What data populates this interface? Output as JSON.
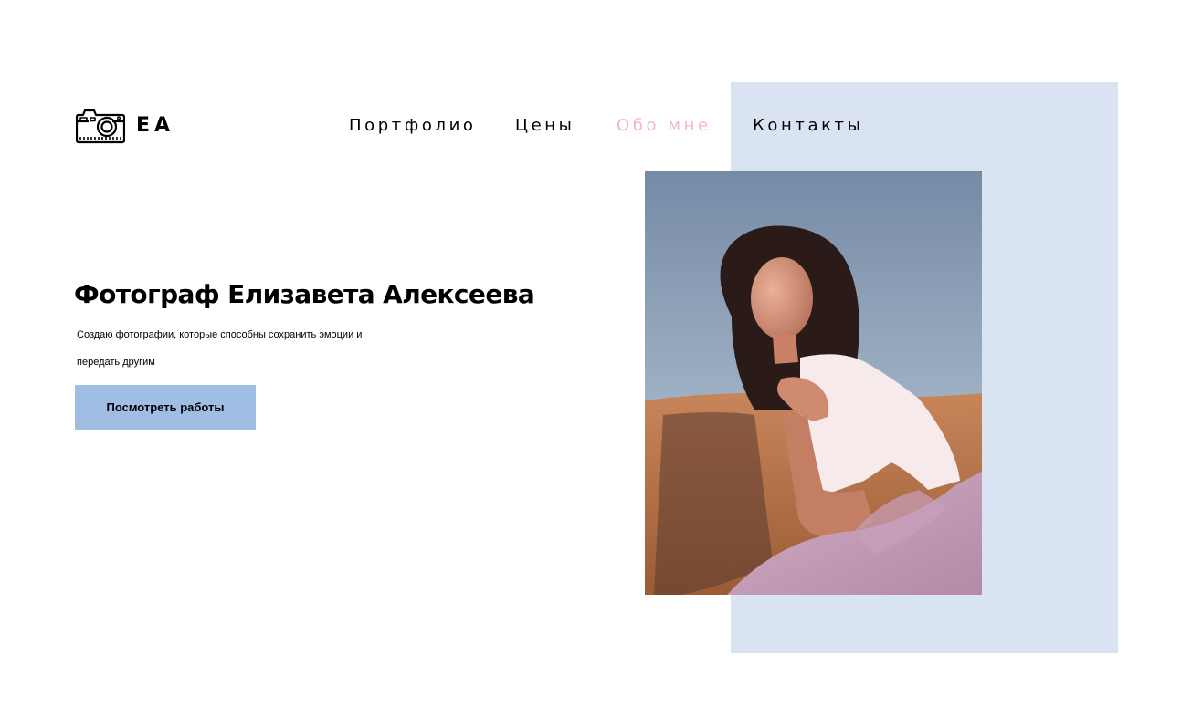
{
  "brand": {
    "icon": "camera-icon",
    "initials": "EA"
  },
  "nav": {
    "items": [
      {
        "label": "Портфолио",
        "active": false
      },
      {
        "label": "Цены",
        "active": false
      },
      {
        "label": "Обо мне",
        "active": true
      },
      {
        "label": "Контакты",
        "active": false
      }
    ]
  },
  "hero": {
    "title": "Фотограф Елизавета Алексеева",
    "subtitle": "Создаю фотографии, которые способны сохранить эмоции и передать другим",
    "cta_label": "Посмотреть работы"
  },
  "colors": {
    "accent_panel": "#d9e3f1",
    "button": "#a0bde3",
    "nav_active": "#f4b7be",
    "text": "#000000"
  }
}
